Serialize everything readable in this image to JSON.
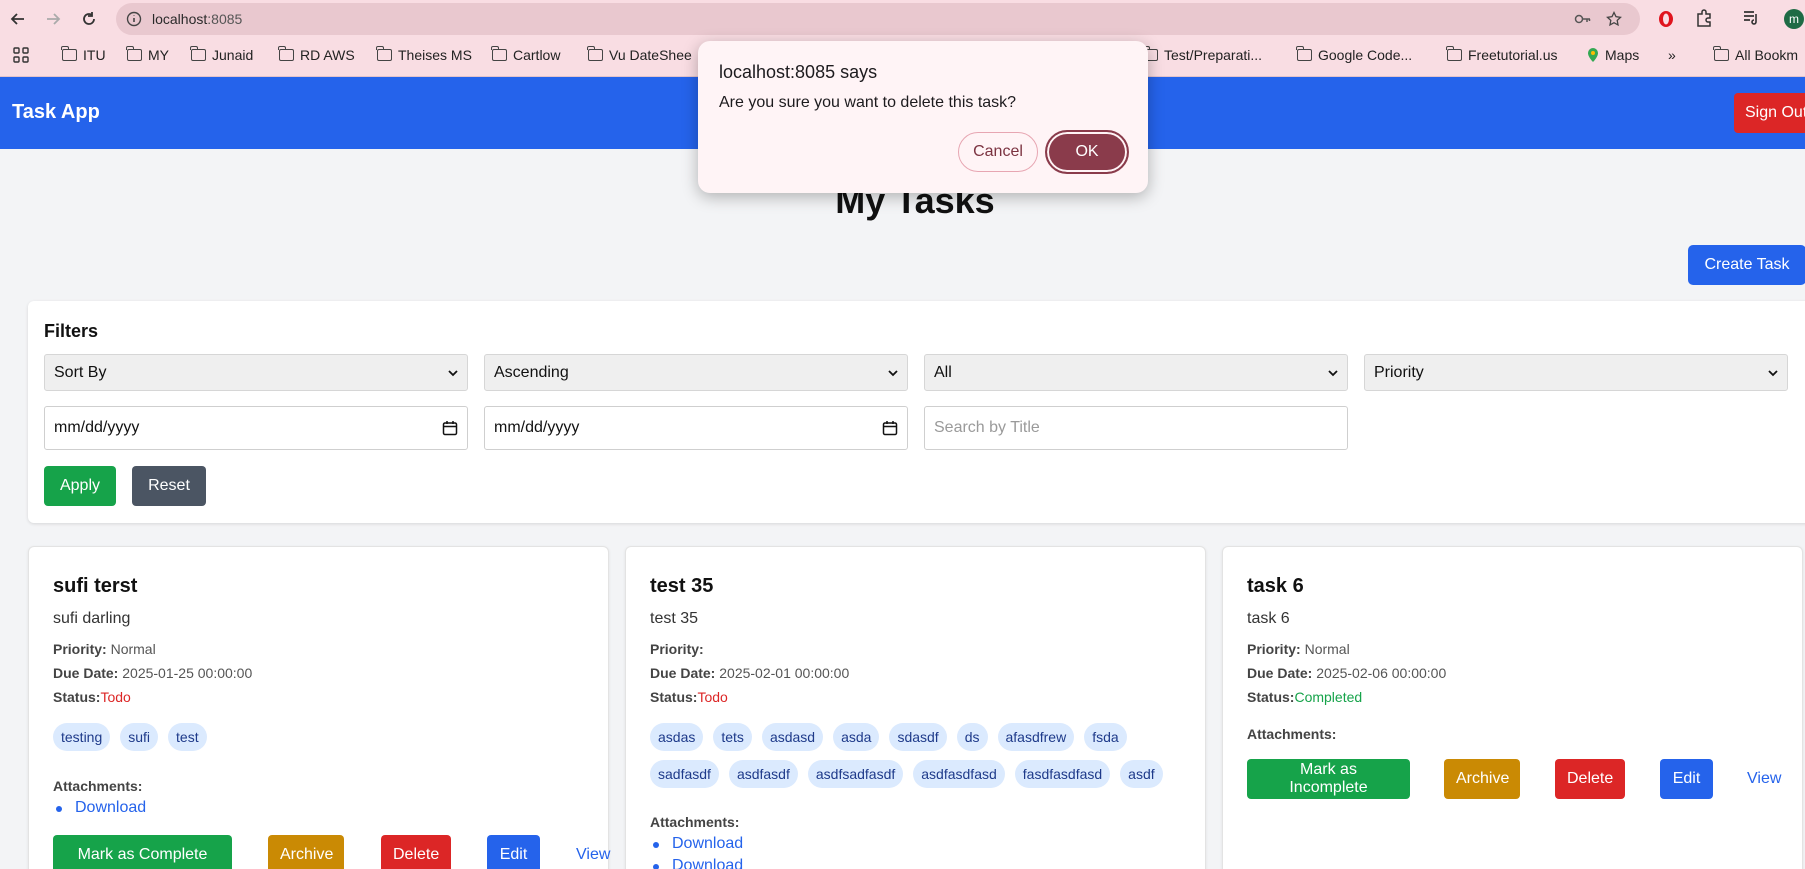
{
  "browser": {
    "url_host": "localhost",
    "url_port": ":8085",
    "bookmarks": [
      "ITU",
      "MY",
      "Junaid",
      "RD AWS",
      "Theises MS",
      "Cartlow",
      "Vu DateShee",
      "Test/Preparati...",
      "Google Code...",
      "Freetutorial.us",
      "Maps",
      "All Bookm"
    ],
    "more": "»",
    "profile_initial": "m"
  },
  "header": {
    "title": "Task App",
    "signout_label": "Sign Out"
  },
  "main": {
    "heading": "My Tasks",
    "create_label": "Create Task"
  },
  "filters": {
    "title": "Filters",
    "sort_by": "Sort By",
    "order": "Ascending",
    "status": "All",
    "priority": "Priority",
    "date_from_placeholder": "mm/dd/yyyy",
    "date_to_placeholder": "mm/dd/yyyy",
    "search_placeholder": "Search by Title",
    "apply_label": "Apply",
    "reset_label": "Reset"
  },
  "labels": {
    "priority": "Priority:",
    "due_date": "Due Date:",
    "status": "Status:",
    "attachments": "Attachments:",
    "mark_complete": "Mark as Complete",
    "mark_incomplete": "Mark as Incomplete",
    "archive": "Archive",
    "delete": "Delete",
    "edit": "Edit",
    "view": "View",
    "download": "Download"
  },
  "tasks": [
    {
      "title": "sufi terst",
      "description": "sufi darling",
      "priority": "Normal",
      "due_date": "2025-01-25 00:00:00",
      "status": "Todo",
      "tags": [
        "testing",
        "sufi",
        "test"
      ],
      "attachments": [
        "Download"
      ]
    },
    {
      "title": "test 35",
      "description": "test 35",
      "priority": "",
      "due_date": "2025-02-01 00:00:00",
      "status": "Todo",
      "tags": [
        "asdas",
        "tets",
        "asdasd",
        "asda",
        "sdasdf",
        "ds",
        "afasdfrew",
        "fsda",
        "sadfasdf",
        "asdfasdf",
        "asdfsadfasdf",
        "asdfasdfasd",
        "fasdfasdfasd",
        "asdf"
      ],
      "attachments": [
        "Download",
        "Download"
      ]
    },
    {
      "title": "task 6",
      "description": "task 6",
      "priority": "Normal",
      "due_date": "2025-02-06 00:00:00",
      "status": "Completed",
      "tags": [],
      "attachments": []
    }
  ],
  "colors": {
    "todo": "#dc2626",
    "completed": "#16a34a",
    "accent": "#2563eb"
  },
  "dialog": {
    "title": "localhost:8085 says",
    "message": "Are you sure you want to delete this task?",
    "cancel_label": "Cancel",
    "ok_label": "OK"
  }
}
